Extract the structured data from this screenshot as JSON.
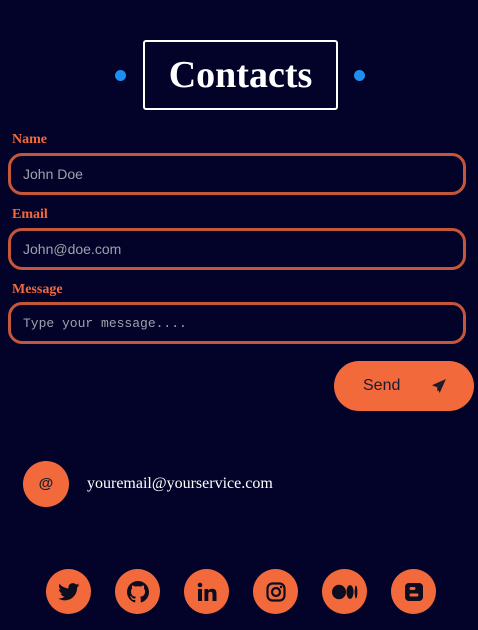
{
  "header": {
    "title": "Contacts"
  },
  "form": {
    "name": {
      "label": "Name",
      "placeholder": "John Doe",
      "value": ""
    },
    "email": {
      "label": "Email",
      "placeholder": "John@doe.com",
      "value": ""
    },
    "message": {
      "label": "Message",
      "placeholder": "Type your message....",
      "value": ""
    },
    "send_label": "Send",
    "send_icon": "paper-plane-icon"
  },
  "contact": {
    "badge_symbol": "@",
    "email": "youremail@yourservice.com"
  },
  "social": [
    {
      "icon": "twitter-icon"
    },
    {
      "icon": "github-icon"
    },
    {
      "icon": "linkedin-icon"
    },
    {
      "icon": "instagram-icon"
    },
    {
      "icon": "medium-icon"
    },
    {
      "icon": "blogger-icon"
    }
  ],
  "colors": {
    "background": "#03032a",
    "accent": "#f26a3c",
    "field_border": "#c4573a",
    "dot": "#1d8ff0",
    "text": "#ffffff"
  }
}
